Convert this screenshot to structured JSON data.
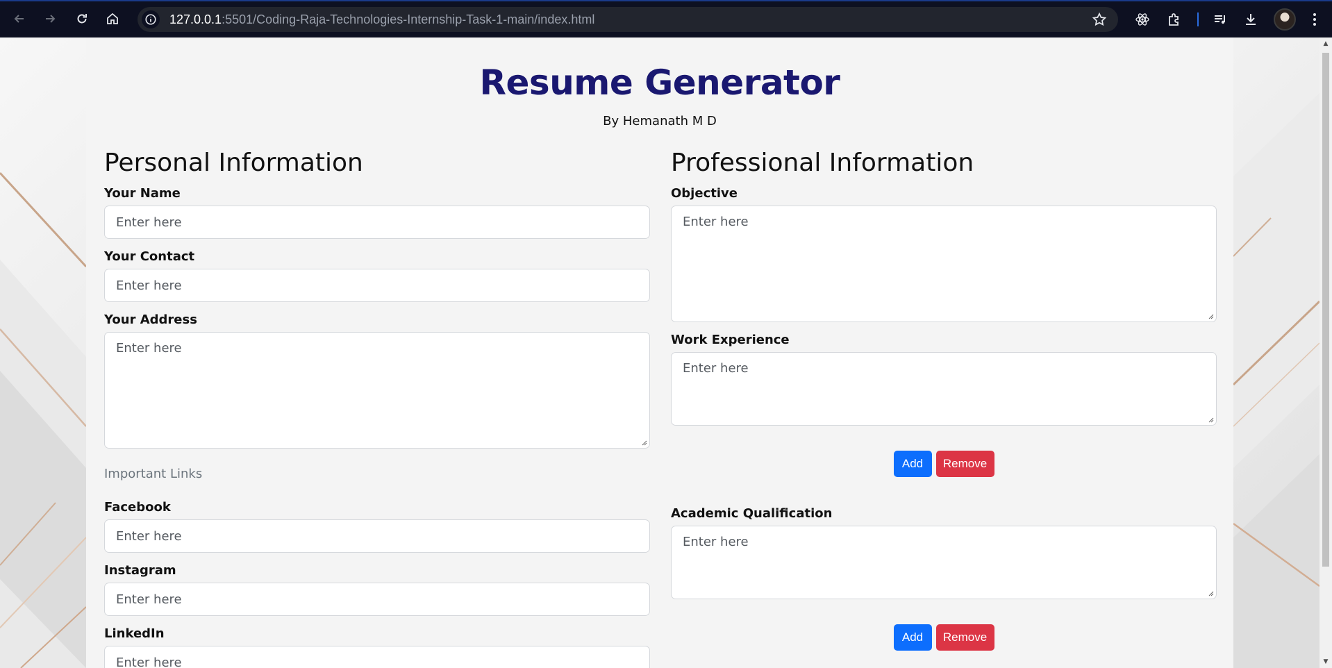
{
  "browser": {
    "url_host": "127.0.0.1",
    "url_rest": ":5501/Coding-Raja-Technologies-Internship-Task-1-main/index.html"
  },
  "page": {
    "title": "Resume Generator",
    "byline": "By Hemanath M D"
  },
  "personal": {
    "heading": "Personal Information",
    "name_label": "Your Name",
    "contact_label": "Your Contact",
    "address_label": "Your Address",
    "links_heading": "Important Links",
    "facebook_label": "Facebook",
    "instagram_label": "Instagram",
    "linkedin_label": "LinkedIn",
    "placeholder": "Enter here"
  },
  "professional": {
    "heading": "Professional Information",
    "objective_label": "Objective",
    "work_label": "Work Experience",
    "academic_label": "Academic Qualification",
    "placeholder": "Enter here",
    "add_label": "Add",
    "remove_label": "Remove"
  },
  "colors": {
    "title": "#1a1870",
    "add": "#0d6efd",
    "remove": "#dc3545"
  }
}
